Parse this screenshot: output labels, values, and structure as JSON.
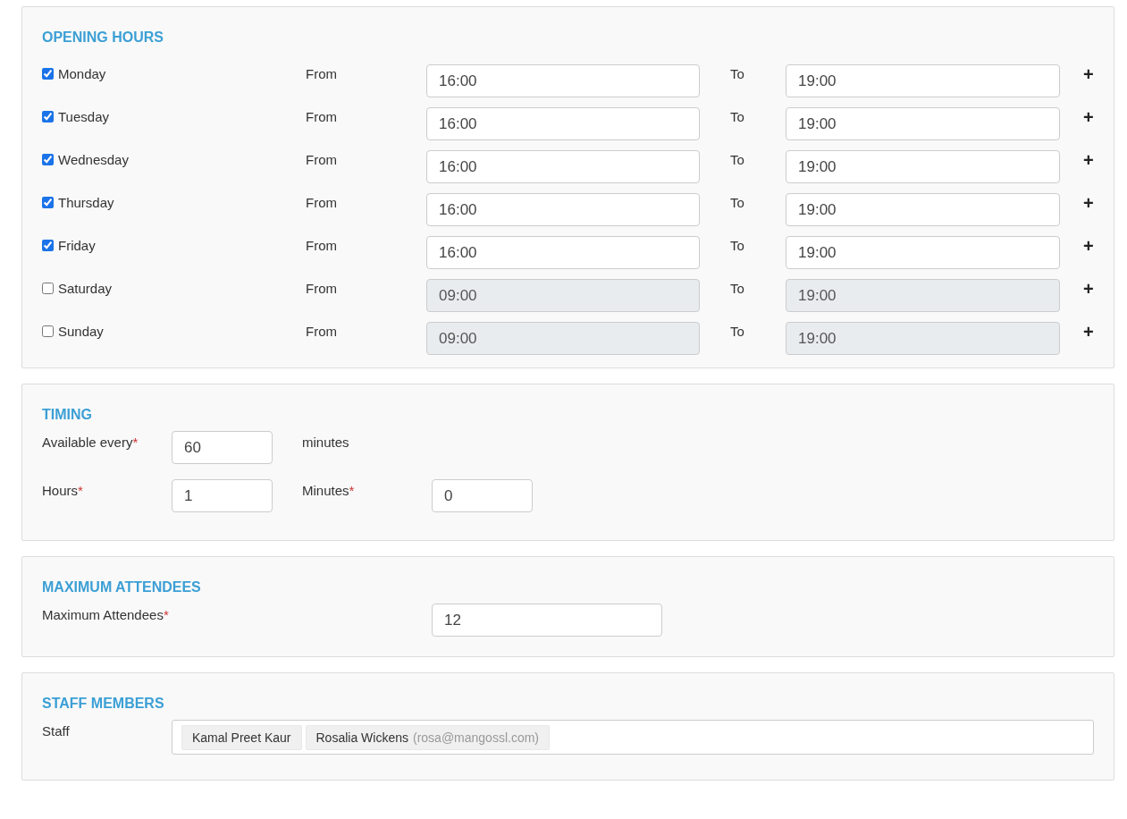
{
  "opening_hours": {
    "title": "OPENING HOURS",
    "days": [
      {
        "day": "Monday",
        "checked": true,
        "from_label": "From",
        "from": "16:00",
        "to_label": "To",
        "to": "19:00",
        "add": "+"
      },
      {
        "day": "Tuesday",
        "checked": true,
        "from_label": "From",
        "from": "16:00",
        "to_label": "To",
        "to": "19:00",
        "add": "+"
      },
      {
        "day": "Wednesday",
        "checked": true,
        "from_label": "From",
        "from": "16:00",
        "to_label": "To",
        "to": "19:00",
        "add": "+"
      },
      {
        "day": "Thursday",
        "checked": true,
        "from_label": "From",
        "from": "16:00",
        "to_label": "To",
        "to": "19:00",
        "add": "+"
      },
      {
        "day": "Friday",
        "checked": true,
        "from_label": "From",
        "from": "16:00",
        "to_label": "To",
        "to": "19:00",
        "add": "+"
      },
      {
        "day": "Saturday",
        "checked": false,
        "from_label": "From",
        "from": "09:00",
        "to_label": "To",
        "to": "19:00",
        "add": "+"
      },
      {
        "day": "Sunday",
        "checked": false,
        "from_label": "From",
        "from": "09:00",
        "to_label": "To",
        "to": "19:00",
        "add": "+"
      }
    ]
  },
  "timing": {
    "title": "TIMING",
    "available_every": {
      "label": "Available every",
      "required_mark": "*",
      "value": "60",
      "unit": "minutes"
    },
    "hours": {
      "label": "Hours",
      "required_mark": "*",
      "value": "1"
    },
    "minutes": {
      "label": "Minutes",
      "required_mark": "*",
      "value": "0"
    }
  },
  "maximum_attendees": {
    "title": "MAXIMUM ATTENDEES",
    "label": "Maximum Attendees",
    "required_mark": "*",
    "value": "12"
  },
  "staff_members": {
    "title": "STAFF MEMBERS",
    "label": "Staff",
    "tags": [
      {
        "name": "Kamal Preet Kaur"
      },
      {
        "name": "Rosalia Wickens",
        "email": "(rosa@mangossl.com)"
      }
    ]
  }
}
